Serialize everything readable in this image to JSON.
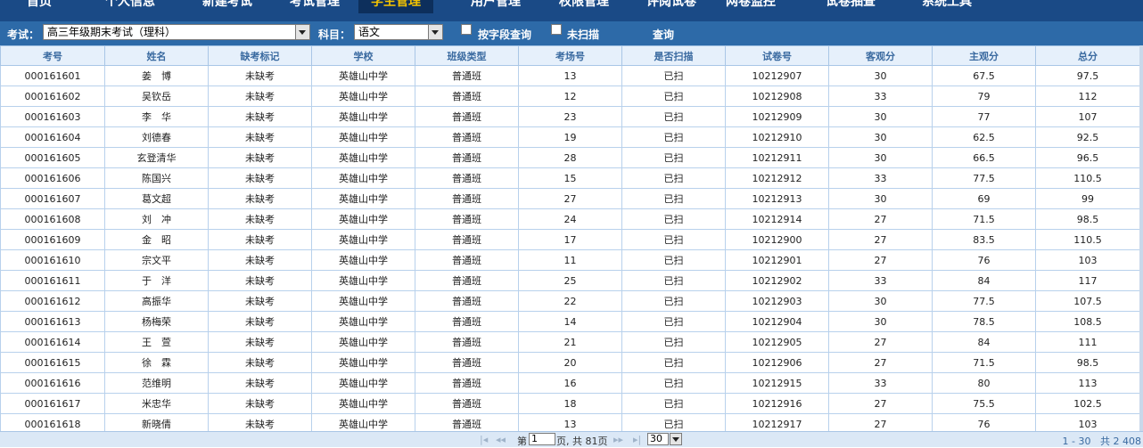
{
  "nav": {
    "tabs": [
      {
        "label": "首页"
      },
      {
        "label": "个人信息"
      },
      {
        "label": "新建考试"
      },
      {
        "label": "考试管理"
      },
      {
        "label": "学生管理"
      },
      {
        "label": "用户管理"
      },
      {
        "label": "权限管理"
      },
      {
        "label": "评阅试卷"
      },
      {
        "label": "网卷监控"
      },
      {
        "label": "试卷抽查"
      },
      {
        "label": "系统工具"
      }
    ],
    "active_index": 4
  },
  "filter": {
    "exam_label": "考试：",
    "exam_value": "高三年级期末考试（理科）",
    "subject_label": "科目：",
    "subject_value": "语文",
    "by_field_label": "按字段查询",
    "unscanned_label": "未扫描",
    "query_label": "查询"
  },
  "table": {
    "columns": [
      "考号",
      "姓名",
      "缺考标记",
      "学校",
      "班级类型",
      "考场号",
      "是否扫描",
      "试卷号",
      "客观分",
      "主观分",
      "总分"
    ],
    "rows": [
      [
        "000161601",
        "姜　博",
        "未缺考",
        "英雄山中学",
        "普通班",
        "13",
        "已扫",
        "10212907",
        "30",
        "67.5",
        "97.5"
      ],
      [
        "000161602",
        "吴钦岳",
        "未缺考",
        "英雄山中学",
        "普通班",
        "12",
        "已扫",
        "10212908",
        "33",
        "79",
        "112"
      ],
      [
        "000161603",
        "李　华",
        "未缺考",
        "英雄山中学",
        "普通班",
        "23",
        "已扫",
        "10212909",
        "30",
        "77",
        "107"
      ],
      [
        "000161604",
        "刘德春",
        "未缺考",
        "英雄山中学",
        "普通班",
        "19",
        "已扫",
        "10212910",
        "30",
        "62.5",
        "92.5"
      ],
      [
        "000161605",
        "玄登清华",
        "未缺考",
        "英雄山中学",
        "普通班",
        "28",
        "已扫",
        "10212911",
        "30",
        "66.5",
        "96.5"
      ],
      [
        "000161606",
        "陈国兴",
        "未缺考",
        "英雄山中学",
        "普通班",
        "15",
        "已扫",
        "10212912",
        "33",
        "77.5",
        "110.5"
      ],
      [
        "000161607",
        "葛文超",
        "未缺考",
        "英雄山中学",
        "普通班",
        "27",
        "已扫",
        "10212913",
        "30",
        "69",
        "99"
      ],
      [
        "000161608",
        "刘　冲",
        "未缺考",
        "英雄山中学",
        "普通班",
        "24",
        "已扫",
        "10212914",
        "27",
        "71.5",
        "98.5"
      ],
      [
        "000161609",
        "金　昭",
        "未缺考",
        "英雄山中学",
        "普通班",
        "17",
        "已扫",
        "10212900",
        "27",
        "83.5",
        "110.5"
      ],
      [
        "000161610",
        "宗文平",
        "未缺考",
        "英雄山中学",
        "普通班",
        "11",
        "已扫",
        "10212901",
        "27",
        "76",
        "103"
      ],
      [
        "000161611",
        "于　洋",
        "未缺考",
        "英雄山中学",
        "普通班",
        "25",
        "已扫",
        "10212902",
        "33",
        "84",
        "117"
      ],
      [
        "000161612",
        "高振华",
        "未缺考",
        "英雄山中学",
        "普通班",
        "22",
        "已扫",
        "10212903",
        "30",
        "77.5",
        "107.5"
      ],
      [
        "000161613",
        "杨梅荣",
        "未缺考",
        "英雄山中学",
        "普通班",
        "14",
        "已扫",
        "10212904",
        "30",
        "78.5",
        "108.5"
      ],
      [
        "000161614",
        "王　萱",
        "未缺考",
        "英雄山中学",
        "普通班",
        "21",
        "已扫",
        "10212905",
        "27",
        "84",
        "111"
      ],
      [
        "000161615",
        "徐　霖",
        "未缺考",
        "英雄山中学",
        "普通班",
        "20",
        "已扫",
        "10212906",
        "27",
        "71.5",
        "98.5"
      ],
      [
        "000161616",
        "范维明",
        "未缺考",
        "英雄山中学",
        "普通班",
        "16",
        "已扫",
        "10212915",
        "33",
        "80",
        "113"
      ],
      [
        "000161617",
        "米忠华",
        "未缺考",
        "英雄山中学",
        "普通班",
        "18",
        "已扫",
        "10212916",
        "27",
        "75.5",
        "102.5"
      ],
      [
        "000161618",
        "新晓倩",
        "未缺考",
        "英雄山中学",
        "普通班",
        "13",
        "已扫",
        "10212917",
        "27",
        "76",
        "103"
      ]
    ]
  },
  "pager": {
    "page_prefix": "第",
    "page_value": "1",
    "page_suffix": "页, 共 81页",
    "page_size": "30",
    "range_text": "1 - 30",
    "total_text": "共 2 408"
  },
  "colors": {
    "nav_bg": "#1a4a86",
    "filter_bg": "#2d6aa8",
    "active_tab_text": "#f5c400",
    "header_bg": "#e6f0fb",
    "header_text": "#3a6aa0"
  }
}
